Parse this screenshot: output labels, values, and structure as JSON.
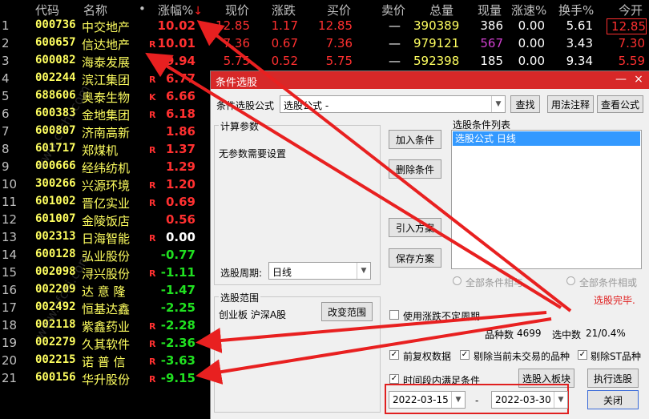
{
  "table": {
    "headers": {
      "code": "代码",
      "name": "名称",
      "dot": "•",
      "pct": "涨幅%",
      "sort_arrow": "↓",
      "price": "现价",
      "chg": "涨跌",
      "bid": "买价",
      "ask": "卖价",
      "vol": "总量",
      "cur": "现量",
      "speed": "涨速%",
      "turnover": "换手%",
      "open": "今开"
    },
    "rows": [
      {
        "n": "1",
        "code": "000736",
        "name": "中交地产",
        "mark": "",
        "pct": "10.02",
        "price": "12.85",
        "chg": "1.17",
        "bid": "12.85",
        "ask": "—",
        "vol": "390389",
        "cur": "386",
        "speed": "0.00",
        "turn": "5.61",
        "open": "12.85"
      },
      {
        "n": "2",
        "code": "600657",
        "name": "信达地产",
        "mark": "R",
        "pct": "10.01",
        "price": "7.36",
        "chg": "0.67",
        "bid": "7.36",
        "ask": "—",
        "vol": "979121",
        "cur": "567",
        "speed": "0.00",
        "turn": "3.43",
        "open": "7.30"
      },
      {
        "n": "3",
        "code": "600082",
        "name": "海泰发展",
        "mark": "",
        "pct": "9.94",
        "price": "5.75",
        "chg": "0.52",
        "bid": "5.75",
        "ask": "—",
        "vol": "592398",
        "cur": "185",
        "speed": "0.00",
        "turn": "9.34",
        "open": "5.59"
      },
      {
        "n": "4",
        "code": "002244",
        "name": "滨江集团",
        "mark": "R",
        "pct": "6.77"
      },
      {
        "n": "5",
        "code": "688606",
        "name": "奥泰生物",
        "mark": "K",
        "pct": "6.66"
      },
      {
        "n": "6",
        "code": "600383",
        "name": "金地集团",
        "mark": "R",
        "pct": "6.18"
      },
      {
        "n": "7",
        "code": "600807",
        "name": "济南高新",
        "mark": "",
        "pct": "1.86"
      },
      {
        "n": "8",
        "code": "601717",
        "name": "郑煤机",
        "mark": "R",
        "pct": "1.37"
      },
      {
        "n": "9",
        "code": "000666",
        "name": "经纬纺机",
        "mark": "",
        "pct": "1.29"
      },
      {
        "n": "10",
        "code": "300266",
        "name": "兴源环境",
        "mark": "R",
        "pct": "1.20"
      },
      {
        "n": "11",
        "code": "601002",
        "name": "晋亿实业",
        "mark": "R",
        "pct": "0.69"
      },
      {
        "n": "12",
        "code": "601007",
        "name": "金陵饭店",
        "mark": "",
        "pct": "0.56"
      },
      {
        "n": "13",
        "code": "002313",
        "name": "日海智能",
        "mark": "R",
        "pct": "0.00"
      },
      {
        "n": "14",
        "code": "600128",
        "name": "弘业股份",
        "mark": "",
        "pct": "-0.77"
      },
      {
        "n": "15",
        "code": "002098",
        "name": "浔兴股份",
        "mark": "R",
        "pct": "-1.11"
      },
      {
        "n": "16",
        "code": "002209",
        "name": "达 意 隆",
        "mark": "",
        "pct": "-1.47"
      },
      {
        "n": "17",
        "code": "002492",
        "name": "恒基达鑫",
        "mark": "",
        "pct": "-2.25"
      },
      {
        "n": "18",
        "code": "002118",
        "name": "紫鑫药业",
        "mark": "R",
        "pct": "-2.28"
      },
      {
        "n": "19",
        "code": "002279",
        "name": "久其软件",
        "mark": "R",
        "pct": "-2.36"
      },
      {
        "n": "20",
        "code": "002215",
        "name": "诺 普 信",
        "mark": "R",
        "pct": "-3.63"
      },
      {
        "n": "21",
        "code": "600156",
        "name": "华升股份",
        "mark": "R",
        "pct": "-9.15"
      }
    ]
  },
  "dialog": {
    "title": "条件选股",
    "formula_label": "条件选股公式",
    "formula_value": "选股公式    -",
    "btn_search": "查找",
    "btn_usage": "用法注释",
    "btn_view": "查看公式",
    "params_group": "计算参数",
    "params_text": "无参数需要设置",
    "btn_add": "加入条件",
    "btn_delete": "删除条件",
    "btn_import": "引入方案",
    "btn_save": "保存方案",
    "list_title": "选股条件列表",
    "list_item": "选股公式  日线",
    "period_label": "选股周期:",
    "period_value": "日线",
    "radio_all": "全部条件相与",
    "radio_or": "全部条件相或",
    "status": "选股完毕.",
    "range_group": "选股范围",
    "range_text": "创业板 沪深A股",
    "btn_change_range": "改变范围",
    "chk_no_period": "使用涨跌不定周期",
    "count_label": "品种数",
    "count_value": "4699",
    "selected_label": "选中数",
    "selected_value": "21/0.4%",
    "chk_fq": "前复权数据",
    "chk_remove_untraded": "剔除当前未交易的品种",
    "chk_remove_st": "剔除ST品种",
    "chk_period": "时间段内满足条件",
    "btn_to_block": "选股入板块",
    "btn_execute": "执行选股",
    "date_start": "2022-03-15",
    "date_sep": "-",
    "date_end": "2022-03-30",
    "btn_close": "关闭",
    "win_min": "—",
    "win_close": "×"
  },
  "colors": {
    "title_bar": "#d72828",
    "rise": "#ff3030",
    "fall": "#20e020",
    "code": "#ffff60",
    "annotation": "#e02020"
  }
}
